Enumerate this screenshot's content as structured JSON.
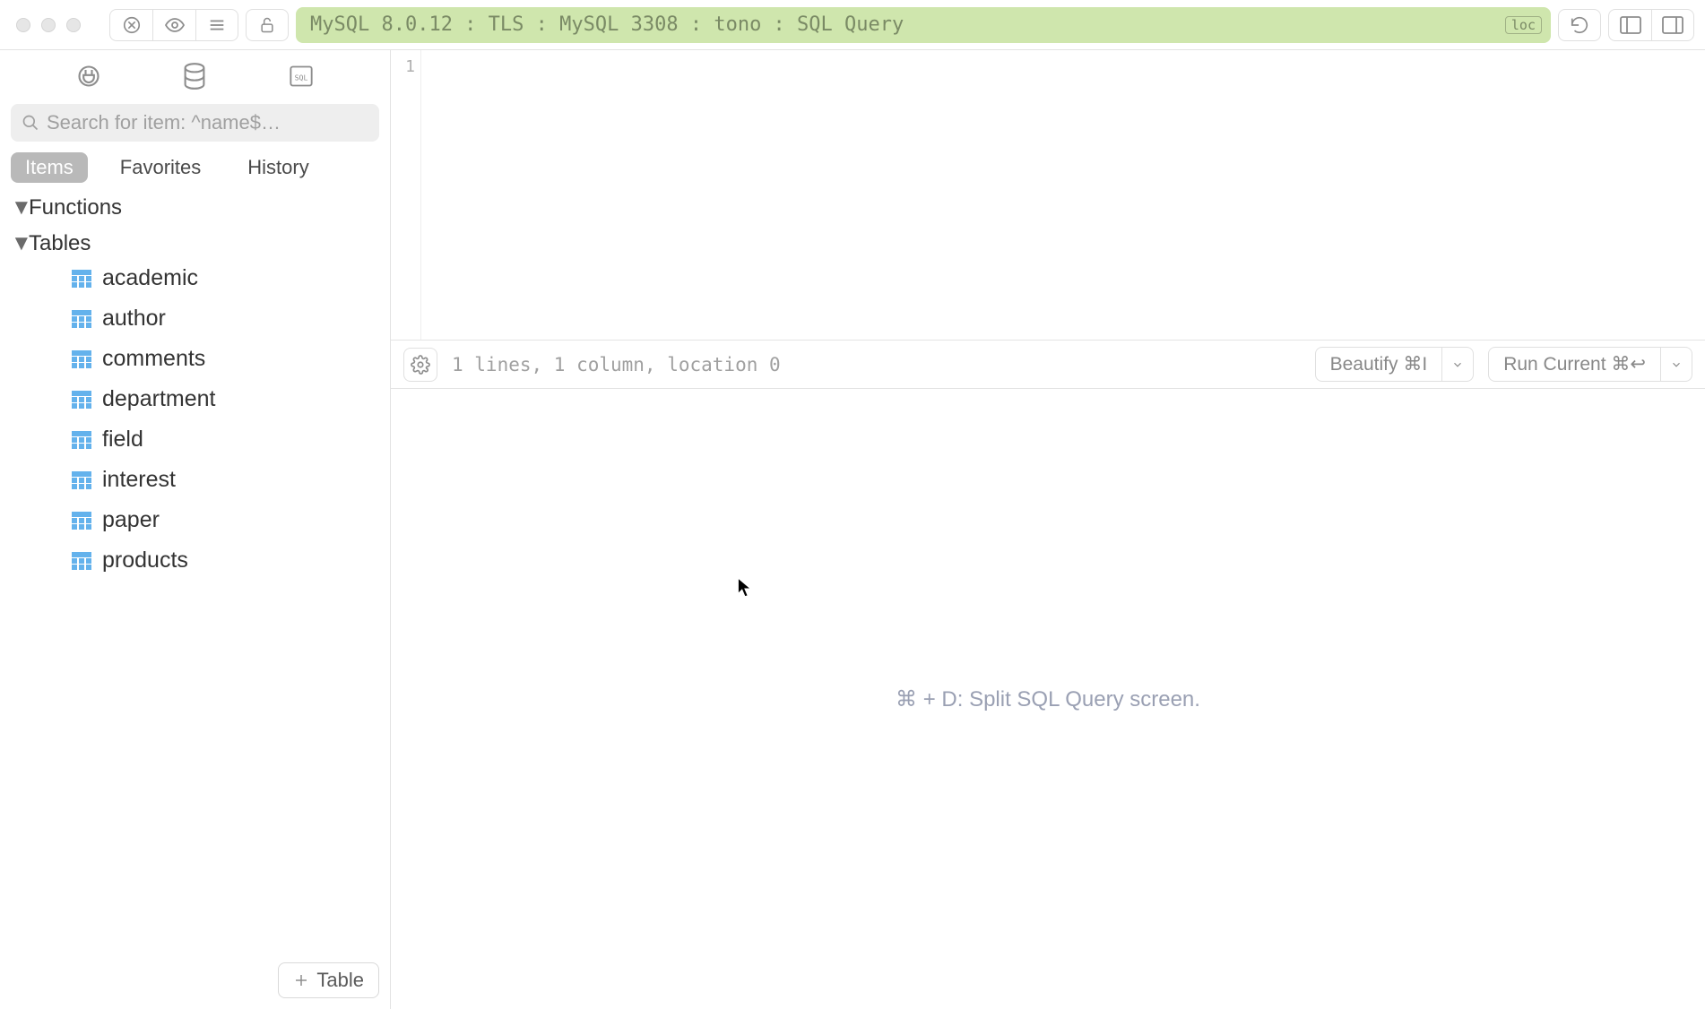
{
  "connection": {
    "title": "MySQL 8.0.12 : TLS : MySQL 3308 : tono : SQL Query",
    "badge": "loc"
  },
  "sidebar": {
    "search_placeholder": "Search for item: ^name$…",
    "tabs": {
      "items": "Items",
      "favorites": "Favorites",
      "history": "History"
    },
    "sections": [
      {
        "label": "Functions",
        "expanded": true
      },
      {
        "label": "Tables",
        "expanded": true
      }
    ],
    "tables": [
      "academic",
      "author",
      "comments",
      "department",
      "field",
      "interest",
      "paper",
      "products"
    ],
    "add_button": "Table"
  },
  "editor": {
    "line_number": "1"
  },
  "statusbar": {
    "text": "1 lines, 1 column, location 0",
    "beautify": "Beautify ⌘I",
    "run": "Run Current ⌘↩"
  },
  "results": {
    "hint": "⌘ + D: Split SQL Query screen."
  }
}
